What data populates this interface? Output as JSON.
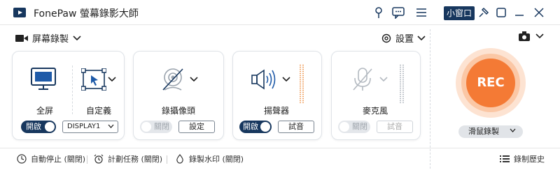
{
  "app": {
    "title": "FonePaw 螢幕錄影大師",
    "mini_window": "小窗口"
  },
  "toolbar": {
    "mode_label": "屏幕錄製",
    "settings_label": "設置"
  },
  "display_card": {
    "fullscreen_label": "全屏",
    "custom_label": "自定義",
    "toggle_label": "開啟",
    "display_select": "DISPLAY1"
  },
  "webcam_card": {
    "label": "錄攝像頭",
    "toggle_label": "關閉",
    "button_label": "設定"
  },
  "speaker_card": {
    "label": "揚聲器",
    "toggle_label": "開啟",
    "button_label": "試音"
  },
  "mic_card": {
    "label": "麥克風",
    "toggle_label": "關閉",
    "button_label": "試音"
  },
  "record": {
    "rec_label": "REC",
    "mode_select": "滑鼠錄製"
  },
  "bottom": {
    "auto_stop": "自動停止 (關閉)",
    "schedule": "計劃任務 (關閉)",
    "watermark": "錄製水印 (關閉)",
    "history": "錄制歷史"
  },
  "colors": {
    "accent": "#17375e",
    "rec": "#f47a35",
    "level": "#f0a060"
  }
}
